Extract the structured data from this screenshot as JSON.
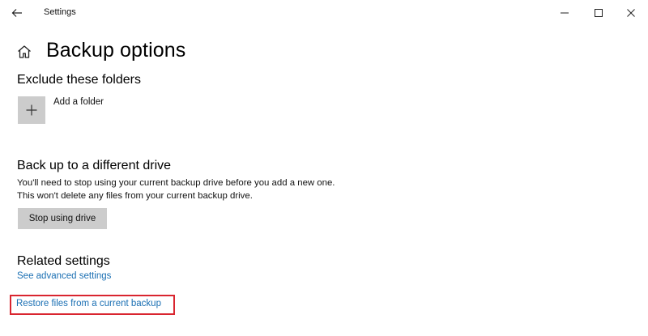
{
  "window": {
    "title": "Settings"
  },
  "page": {
    "title": "Backup options"
  },
  "exclude": {
    "heading": "Exclude these folders",
    "add_label": "Add a folder"
  },
  "drive": {
    "heading": "Back up to a different drive",
    "description": "You'll need to stop using your current backup drive before you add a new one. This won't delete any files from your current backup drive.",
    "button_label": "Stop using drive"
  },
  "related": {
    "heading": "Related settings",
    "advanced_link": "See advanced settings",
    "restore_link": "Restore files from a current backup"
  },
  "colors": {
    "link": "#1a6fb3",
    "highlight": "#d9252f",
    "button_bg": "#cccccc"
  }
}
